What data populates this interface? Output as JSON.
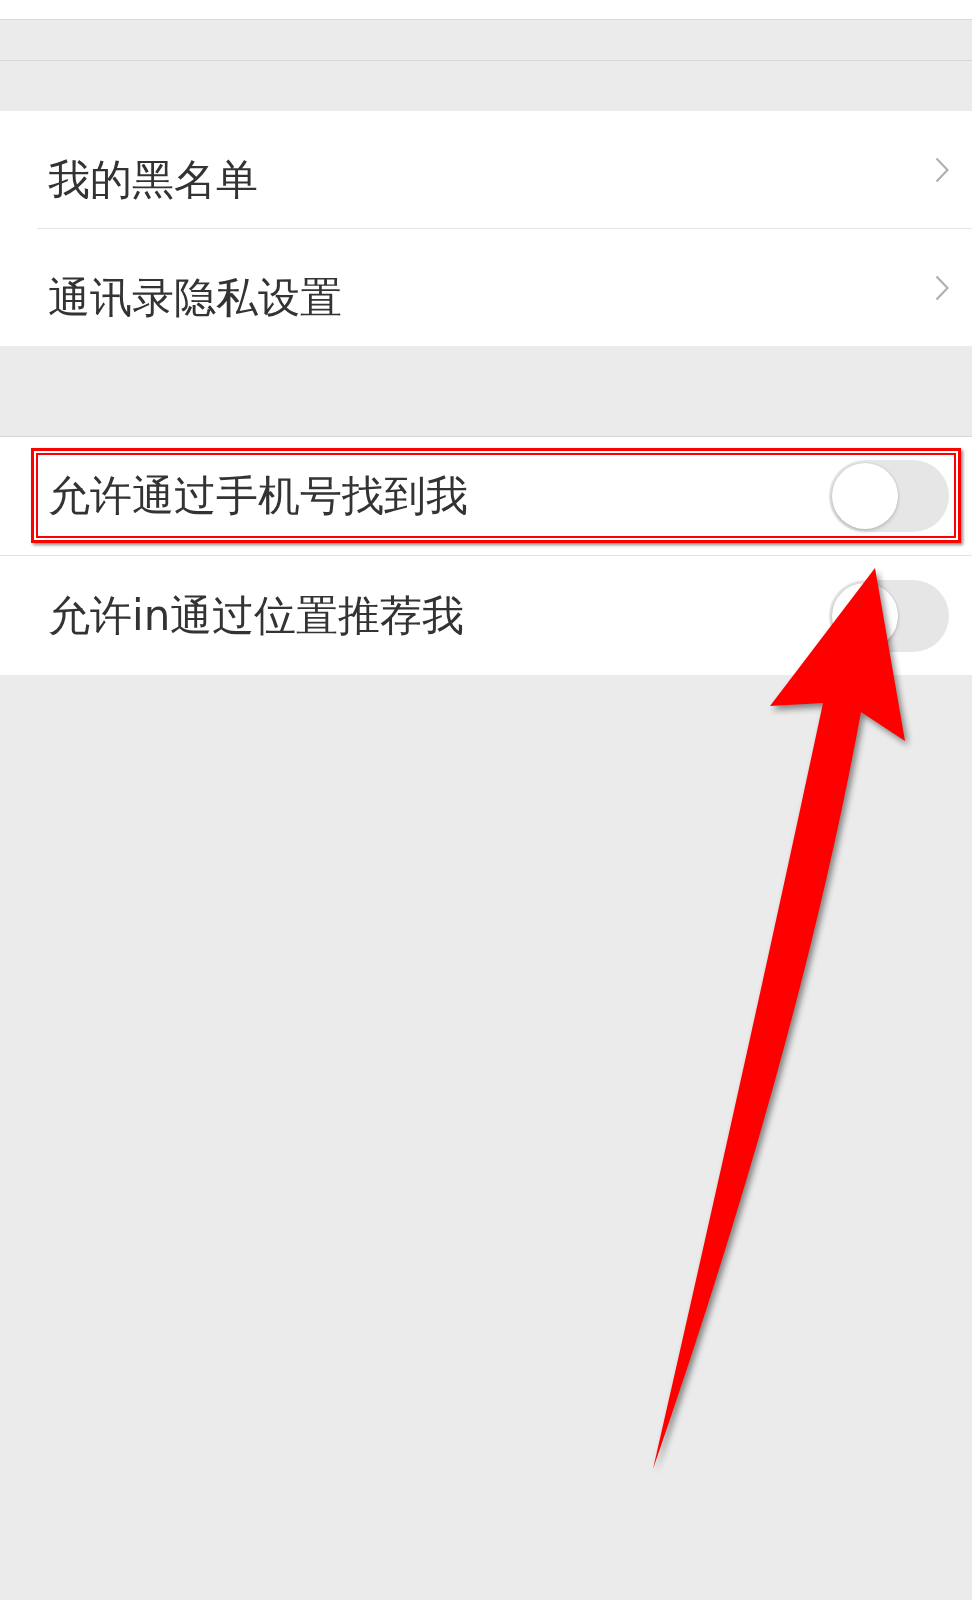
{
  "sections": [
    {
      "kind": "links",
      "items": [
        {
          "label": "我的黑名单"
        },
        {
          "label": "通讯录隐私设置"
        }
      ]
    },
    {
      "kind": "toggles",
      "items": [
        {
          "label": "允许通过手机号找到我",
          "on": false,
          "highlighted": true
        },
        {
          "label": "允许in通过位置推荐我",
          "on": false,
          "highlighted": false
        }
      ]
    }
  ],
  "annotation_arrow": true
}
